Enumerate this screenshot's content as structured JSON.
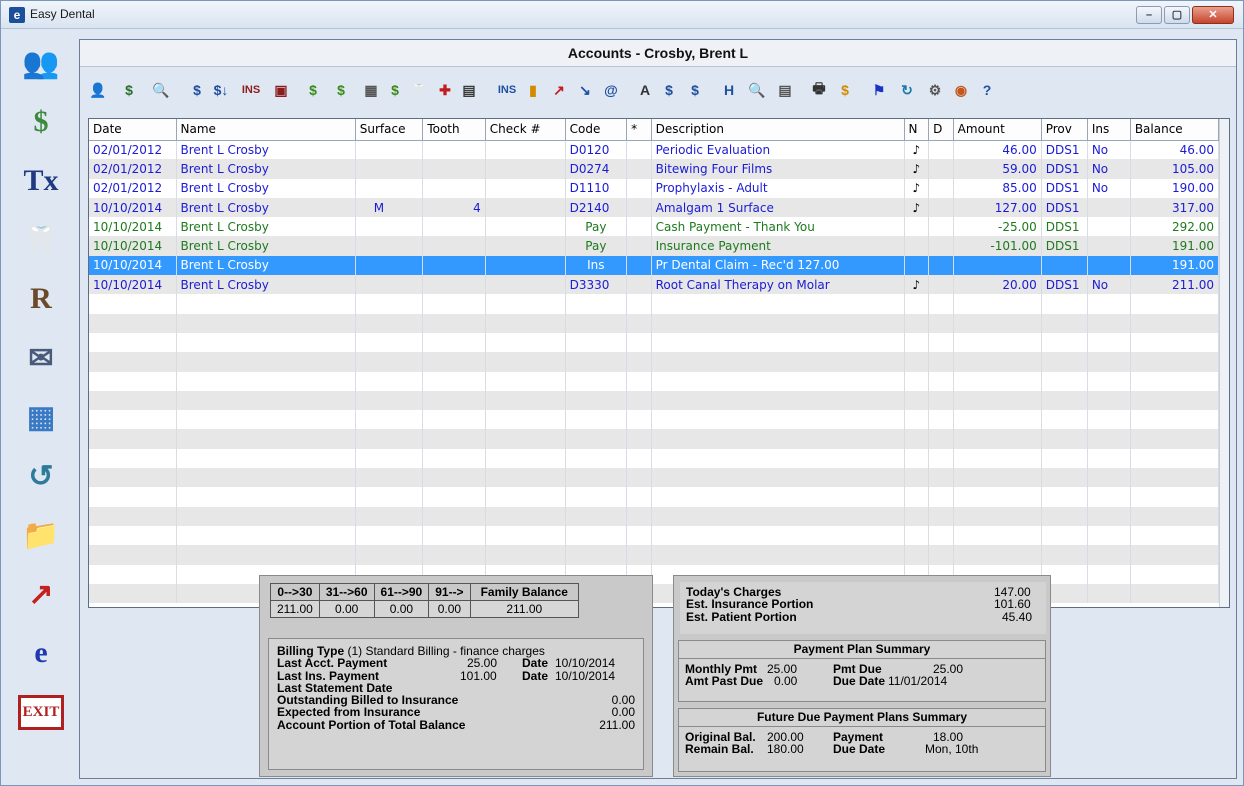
{
  "window": {
    "title": "Easy Dental",
    "minimize_glyph": "–",
    "maximize_glyph": "▢",
    "close_glyph": "✕"
  },
  "account": {
    "title": "Accounts - Crosby, Brent L"
  },
  "sidebar": {
    "items": [
      {
        "name": "family-file-icon",
        "glyph": "👥"
      },
      {
        "name": "account-ledger-icon",
        "glyph": "$"
      },
      {
        "name": "treatment-plan-icon",
        "glyph": "Tx"
      },
      {
        "name": "chart-tooth-icon",
        "glyph": "🦷"
      },
      {
        "name": "prescription-icon",
        "glyph": "R"
      },
      {
        "name": "communication-icon",
        "glyph": "✉"
      },
      {
        "name": "reports-icon",
        "glyph": "▦"
      },
      {
        "name": "continuing-care-icon",
        "glyph": "↺"
      },
      {
        "name": "documents-folder-icon",
        "glyph": "📁"
      },
      {
        "name": "analysis-chart-icon",
        "glyph": "↗"
      },
      {
        "name": "easy-dental-logo-icon",
        "glyph": "e"
      },
      {
        "name": "exit-icon",
        "glyph": "EXIT"
      }
    ]
  },
  "toolbar": {
    "tools": [
      {
        "name": "select-patient-icon",
        "glyph": "👤",
        "color": "#b43a1e"
      },
      {
        "name": "statement-icon",
        "glyph": "$",
        "color": "#2e6b2e"
      },
      {
        "name": "search-icon",
        "glyph": "🔍",
        "color": "#2e6b2e"
      },
      {
        "name": "guarantor-payment-icon",
        "glyph": "$",
        "color": "#1f4fa0"
      },
      {
        "name": "enter-payment-icon",
        "glyph": "$↓",
        "color": "#1f4fa0"
      },
      {
        "name": "insurance-icon",
        "glyph": "INS",
        "color": "#8a1c1c"
      },
      {
        "name": "apply-icon",
        "glyph": "▣",
        "color": "#8a1c1c"
      },
      {
        "name": "enter-charge-icon",
        "glyph": "$",
        "color": "#3a8a1a"
      },
      {
        "name": "enter-adjustment-icon",
        "glyph": "$",
        "color": "#3a8a1a"
      },
      {
        "name": "calculator-icon",
        "glyph": "▦",
        "color": "#555555"
      },
      {
        "name": "transfer-icon",
        "glyph": "$",
        "color": "#3a8a1a"
      },
      {
        "name": "codes-icon",
        "glyph": "🦷",
        "color": "#555555"
      },
      {
        "name": "medical-alert-icon",
        "glyph": "✚",
        "color": "#c21b1b"
      },
      {
        "name": "clipboard-icon",
        "glyph": "▤",
        "color": "#3a3a3a"
      },
      {
        "name": "ins-info-icon",
        "glyph": "INS",
        "color": "#1f4fa0"
      },
      {
        "name": "bar-graph-icon",
        "glyph": "▮",
        "color": "#d28a00"
      },
      {
        "name": "claim-icon",
        "glyph": "↗",
        "color": "#c21b1b"
      },
      {
        "name": "electronic-claim-icon",
        "glyph": "↘",
        "color": "#1f4fa0"
      },
      {
        "name": "email-icon",
        "glyph": "@",
        "color": "#1f4fa0"
      },
      {
        "name": "text-note-icon",
        "glyph": "A",
        "color": "#333333"
      },
      {
        "name": "ledger-note-icon",
        "glyph": "$",
        "color": "#1f4fa0"
      },
      {
        "name": "statement-note-icon",
        "glyph": "$",
        "color": "#1f4fa0"
      },
      {
        "name": "history-icon",
        "glyph": "H",
        "color": "#1f4fa0"
      },
      {
        "name": "magnify-icon",
        "glyph": "🔍",
        "color": "#1f4fa0"
      },
      {
        "name": "list-view-icon",
        "glyph": "▤",
        "color": "#555555"
      },
      {
        "name": "print-icon",
        "glyph": "🖶",
        "color": "#333333"
      },
      {
        "name": "finance-icon",
        "glyph": "$",
        "color": "#d28a00"
      },
      {
        "name": "flag-icon",
        "glyph": "⚑",
        "color": "#1b33c4"
      },
      {
        "name": "refresh-icon",
        "glyph": "↻",
        "color": "#1a7aa8"
      },
      {
        "name": "tools-icon",
        "glyph": "⚙",
        "color": "#555555"
      },
      {
        "name": "support-icon",
        "glyph": "◉",
        "color": "#c2561b"
      },
      {
        "name": "help-icon",
        "glyph": "?",
        "color": "#1f4fa0"
      }
    ]
  },
  "ledger": {
    "columns": [
      "Date",
      "Name",
      "Surface",
      "Tooth",
      "Check #",
      "Code",
      "*",
      "Description",
      "N",
      "D",
      "Amount",
      "Prov",
      "Ins",
      "Balance"
    ],
    "rows": [
      {
        "date": "02/01/2012",
        "name": "Brent L Crosby",
        "surface": "",
        "tooth": "",
        "check": "",
        "code": "D0120",
        "star": "",
        "desc": "Periodic Evaluation",
        "n": "♪",
        "d": "",
        "amount": "46.00",
        "prov": "DDS1",
        "ins": "No",
        "balance": "46.00",
        "color": "blue"
      },
      {
        "date": "02/01/2012",
        "name": "Brent L Crosby",
        "surface": "",
        "tooth": "",
        "check": "",
        "code": "D0274",
        "star": "",
        "desc": "Bitewing Four Films",
        "n": "♪",
        "d": "",
        "amount": "59.00",
        "prov": "DDS1",
        "ins": "No",
        "balance": "105.00",
        "color": "blue"
      },
      {
        "date": "02/01/2012",
        "name": "Brent L Crosby",
        "surface": "",
        "tooth": "",
        "check": "",
        "code": "D1110",
        "star": "",
        "desc": "Prophylaxis - Adult",
        "n": "♪",
        "d": "",
        "amount": "85.00",
        "prov": "DDS1",
        "ins": "No",
        "balance": "190.00",
        "color": "blue"
      },
      {
        "date": "10/10/2014",
        "name": "Brent L Crosby",
        "surface": "M",
        "tooth": "4",
        "check": "",
        "code": "D2140",
        "star": "",
        "desc": "Amalgam 1 Surface",
        "n": "♪",
        "d": "",
        "amount": "127.00",
        "prov": "DDS1",
        "ins": "",
        "balance": "317.00",
        "color": "blue"
      },
      {
        "date": "10/10/2014",
        "name": "Brent L Crosby",
        "surface": "",
        "tooth": "",
        "check": "",
        "code": "Pay",
        "star": "",
        "desc": "Cash Payment - Thank You",
        "n": "",
        "d": "",
        "amount": "-25.00",
        "prov": "DDS1",
        "ins": "",
        "balance": "292.00",
        "color": "green"
      },
      {
        "date": "10/10/2014",
        "name": "Brent L Crosby",
        "surface": "",
        "tooth": "",
        "check": "",
        "code": "Pay",
        "star": "",
        "desc": "Insurance Payment",
        "n": "",
        "d": "",
        "amount": "-101.00",
        "prov": "DDS1",
        "ins": "",
        "balance": "191.00",
        "color": "green"
      },
      {
        "date": "10/10/2014",
        "name": "Brent L Crosby",
        "surface": "",
        "tooth": "",
        "check": "",
        "code": "Ins",
        "star": "",
        "desc": "Pr Dental Claim - Rec'd 127.00",
        "n": "",
        "d": "",
        "amount": "",
        "prov": "",
        "ins": "",
        "balance": "191.00",
        "color": "blue",
        "selected": true
      },
      {
        "date": "10/10/2014",
        "name": "Brent L Crosby",
        "surface": "",
        "tooth": "",
        "check": "",
        "code": "D3330",
        "star": "",
        "desc": "Root Canal Therapy on Molar",
        "n": "♪",
        "d": "",
        "amount": "20.00",
        "prov": "DDS1",
        "ins": "No",
        "balance": "211.00",
        "color": "blue"
      }
    ]
  },
  "aging": {
    "headers": [
      "0-->30",
      "31-->60",
      "61-->90",
      "91-->",
      "Family Balance"
    ],
    "values": [
      "211.00",
      "0.00",
      "0.00",
      "0.00",
      "211.00"
    ]
  },
  "billing": {
    "type_label": "Billing Type",
    "type_value": "(1) Standard Billing - finance charges",
    "last_acct_payment_label": "Last Acct. Payment",
    "last_acct_payment_amount": "25.00",
    "last_acct_payment_date_label": "Date",
    "last_acct_payment_date": "10/10/2014",
    "last_ins_payment_label": "Last Ins. Payment",
    "last_ins_payment_amount": "101.00",
    "last_ins_payment_date_label": "Date",
    "last_ins_payment_date": "10/10/2014",
    "last_statement_label": "Last Statement Date",
    "outstanding_label": "Outstanding Billed to Insurance",
    "outstanding_value": "0.00",
    "expected_label": "Expected from Insurance",
    "expected_value": "0.00",
    "account_portion_label": "Account Portion of Total Balance",
    "account_portion_value": "211.00"
  },
  "today": {
    "charges_label": "Today's Charges",
    "charges_value": "147.00",
    "ins_portion_label": "Est. Insurance Portion",
    "ins_portion_value": "101.60",
    "patient_portion_label": "Est. Patient Portion",
    "patient_portion_value": "45.40"
  },
  "payment_plan": {
    "title": "Payment Plan Summary",
    "monthly_pmt_label": "Monthly Pmt",
    "monthly_pmt_value": "25.00",
    "pmt_due_label": "Pmt Due",
    "pmt_due_value": "25.00",
    "amt_past_due_label": "Amt Past Due",
    "amt_past_due_value": "0.00",
    "due_date_label": "Due Date",
    "due_date_value": "11/01/2014"
  },
  "future_plans": {
    "title": "Future Due Payment Plans Summary",
    "original_bal_label": "Original Bal.",
    "original_bal_value": "200.00",
    "payment_label": "Payment",
    "payment_value": "18.00",
    "remain_bal_label": "Remain Bal.",
    "remain_bal_value": "180.00",
    "due_date_label": "Due Date",
    "due_date_value": "Mon, 10th"
  }
}
